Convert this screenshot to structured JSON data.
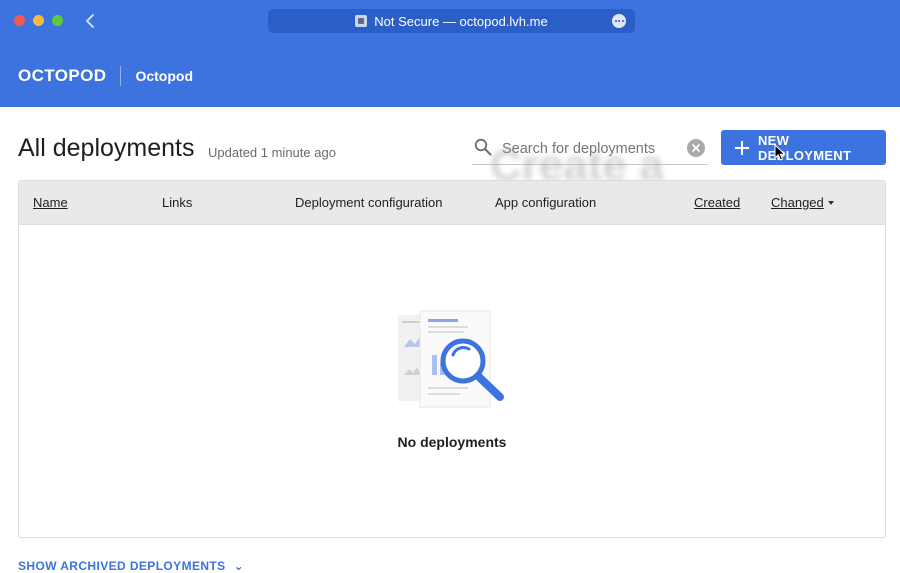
{
  "browser": {
    "url_text": "Not Secure — octopod.lvh.me"
  },
  "header": {
    "logo": "OCTOPOD",
    "project": "Octopod"
  },
  "page": {
    "title": "All deployments",
    "updated": "Updated 1 minute ago"
  },
  "search": {
    "placeholder": "Search for deployments",
    "value": ""
  },
  "new_button": {
    "label": "NEW DEPLOYMENT"
  },
  "overlay_hint": {
    "text": "Create a deployment"
  },
  "table": {
    "columns": [
      {
        "label": "Name",
        "sortable": true
      },
      {
        "label": "Links",
        "sortable": false
      },
      {
        "label": "Deployment configuration",
        "sortable": false
      },
      {
        "label": "App configuration",
        "sortable": false
      },
      {
        "label": "Created",
        "sortable": true
      },
      {
        "label": "Changed",
        "sortable": true,
        "sorted": "desc"
      }
    ],
    "empty_text": "No deployments"
  },
  "footer": {
    "archived_label": "SHOW ARCHIVED DEPLOYMENTS"
  },
  "colors": {
    "brand_blue": "#3d73df",
    "header_bg": "#e9e9e9"
  }
}
